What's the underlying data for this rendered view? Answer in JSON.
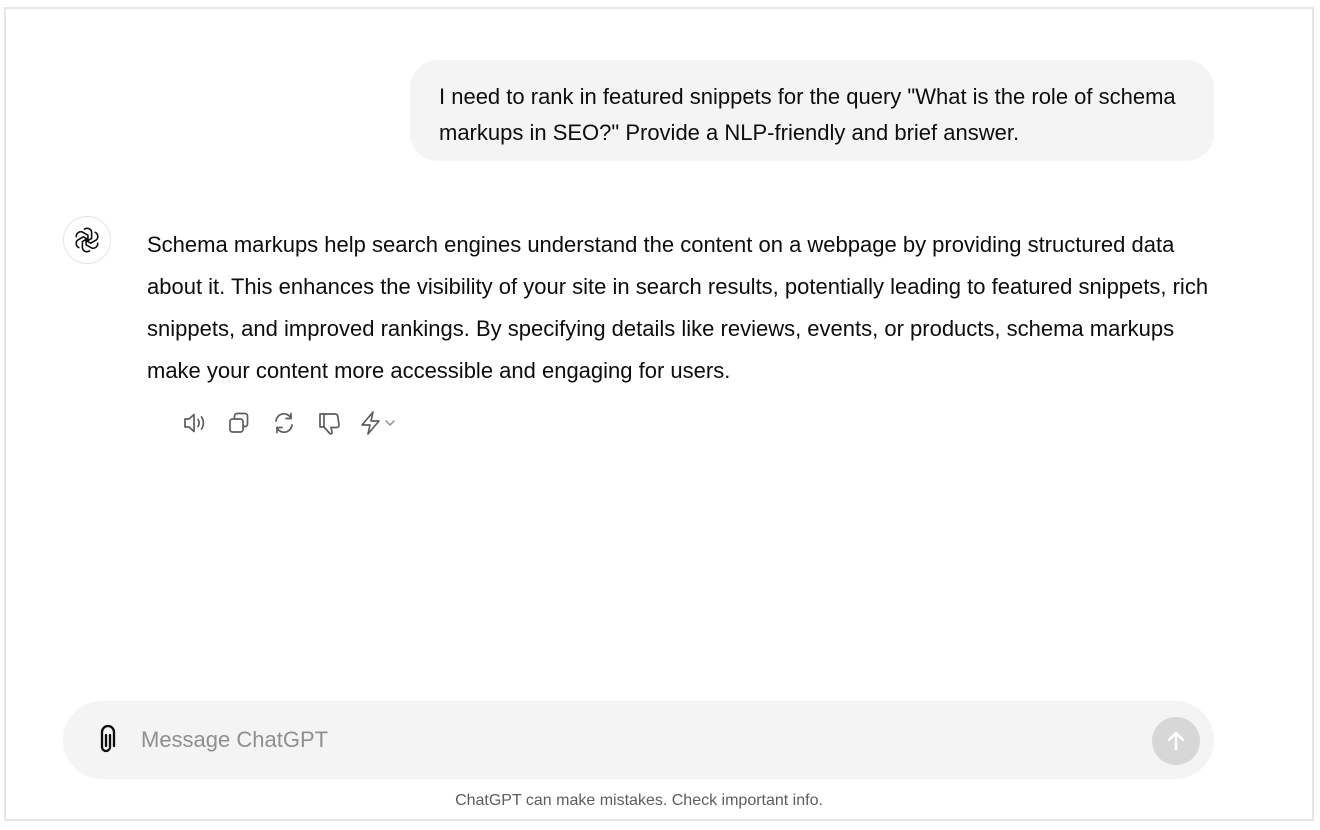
{
  "conversation": {
    "user_message": "I need to rank in featured snippets for the query \"What is the role of schema markups in SEO?\" Provide a NLP-friendly and brief answer.",
    "assistant_message": "Schema markups help search engines understand the content on a webpage by providing structured data about it. This enhances the visibility of your site in search results, potentially leading to featured snippets, rich snippets, and improved rankings. By specifying details like reviews, events, or products, schema markups make your content more accessible and engaging for users.",
    "assistant_avatar_icon": "openai-logo-icon"
  },
  "message_actions": [
    {
      "name": "read-aloud",
      "icon": "speaker-icon"
    },
    {
      "name": "copy",
      "icon": "copy-icon"
    },
    {
      "name": "regenerate",
      "icon": "refresh-icon"
    },
    {
      "name": "bad-response",
      "icon": "thumbs-down-icon"
    },
    {
      "name": "switch-model",
      "icon": "lightning-icon"
    }
  ],
  "composer": {
    "placeholder": "Message ChatGPT",
    "value": "",
    "attach_icon": "paperclip-icon",
    "send_icon": "arrow-up-icon"
  },
  "footer": {
    "disclaimer": "ChatGPT can make mistakes. Check important info."
  },
  "colors": {
    "bubble_bg": "#f4f4f4",
    "send_disabled": "#d7d7d7",
    "text": "#0d0d0d",
    "muted": "#5d5d5d",
    "icon": "#5d5d5d"
  }
}
